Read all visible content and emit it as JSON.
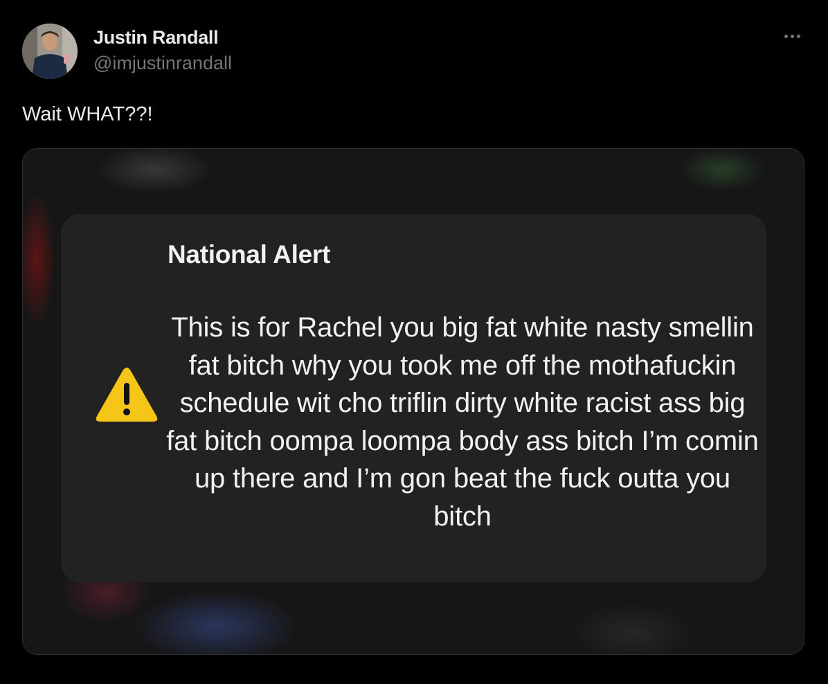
{
  "author": {
    "display_name": "Justin Randall",
    "handle": "@imjustinrandall"
  },
  "tweet": {
    "text": "Wait WHAT??!"
  },
  "media": {
    "alert_title": "National Alert",
    "alert_icon": "warning-triangle-icon",
    "alert_icon_color": "#f5c518",
    "alert_body": "This is for Rachel you big fat white nasty smellin fat bitch why you took me off the mothafuckin schedule wit cho triflin dirty white racist ass big fat bitch oompa loompa body ass bitch I’m comin up there and I’m gon beat the fuck outta you bitch"
  },
  "colors": {
    "background": "#000000",
    "primary_text": "#e7e9ea",
    "secondary_text": "#71767b",
    "card_background": "#222222"
  },
  "icons": {
    "more": "more-horizontal-icon"
  }
}
